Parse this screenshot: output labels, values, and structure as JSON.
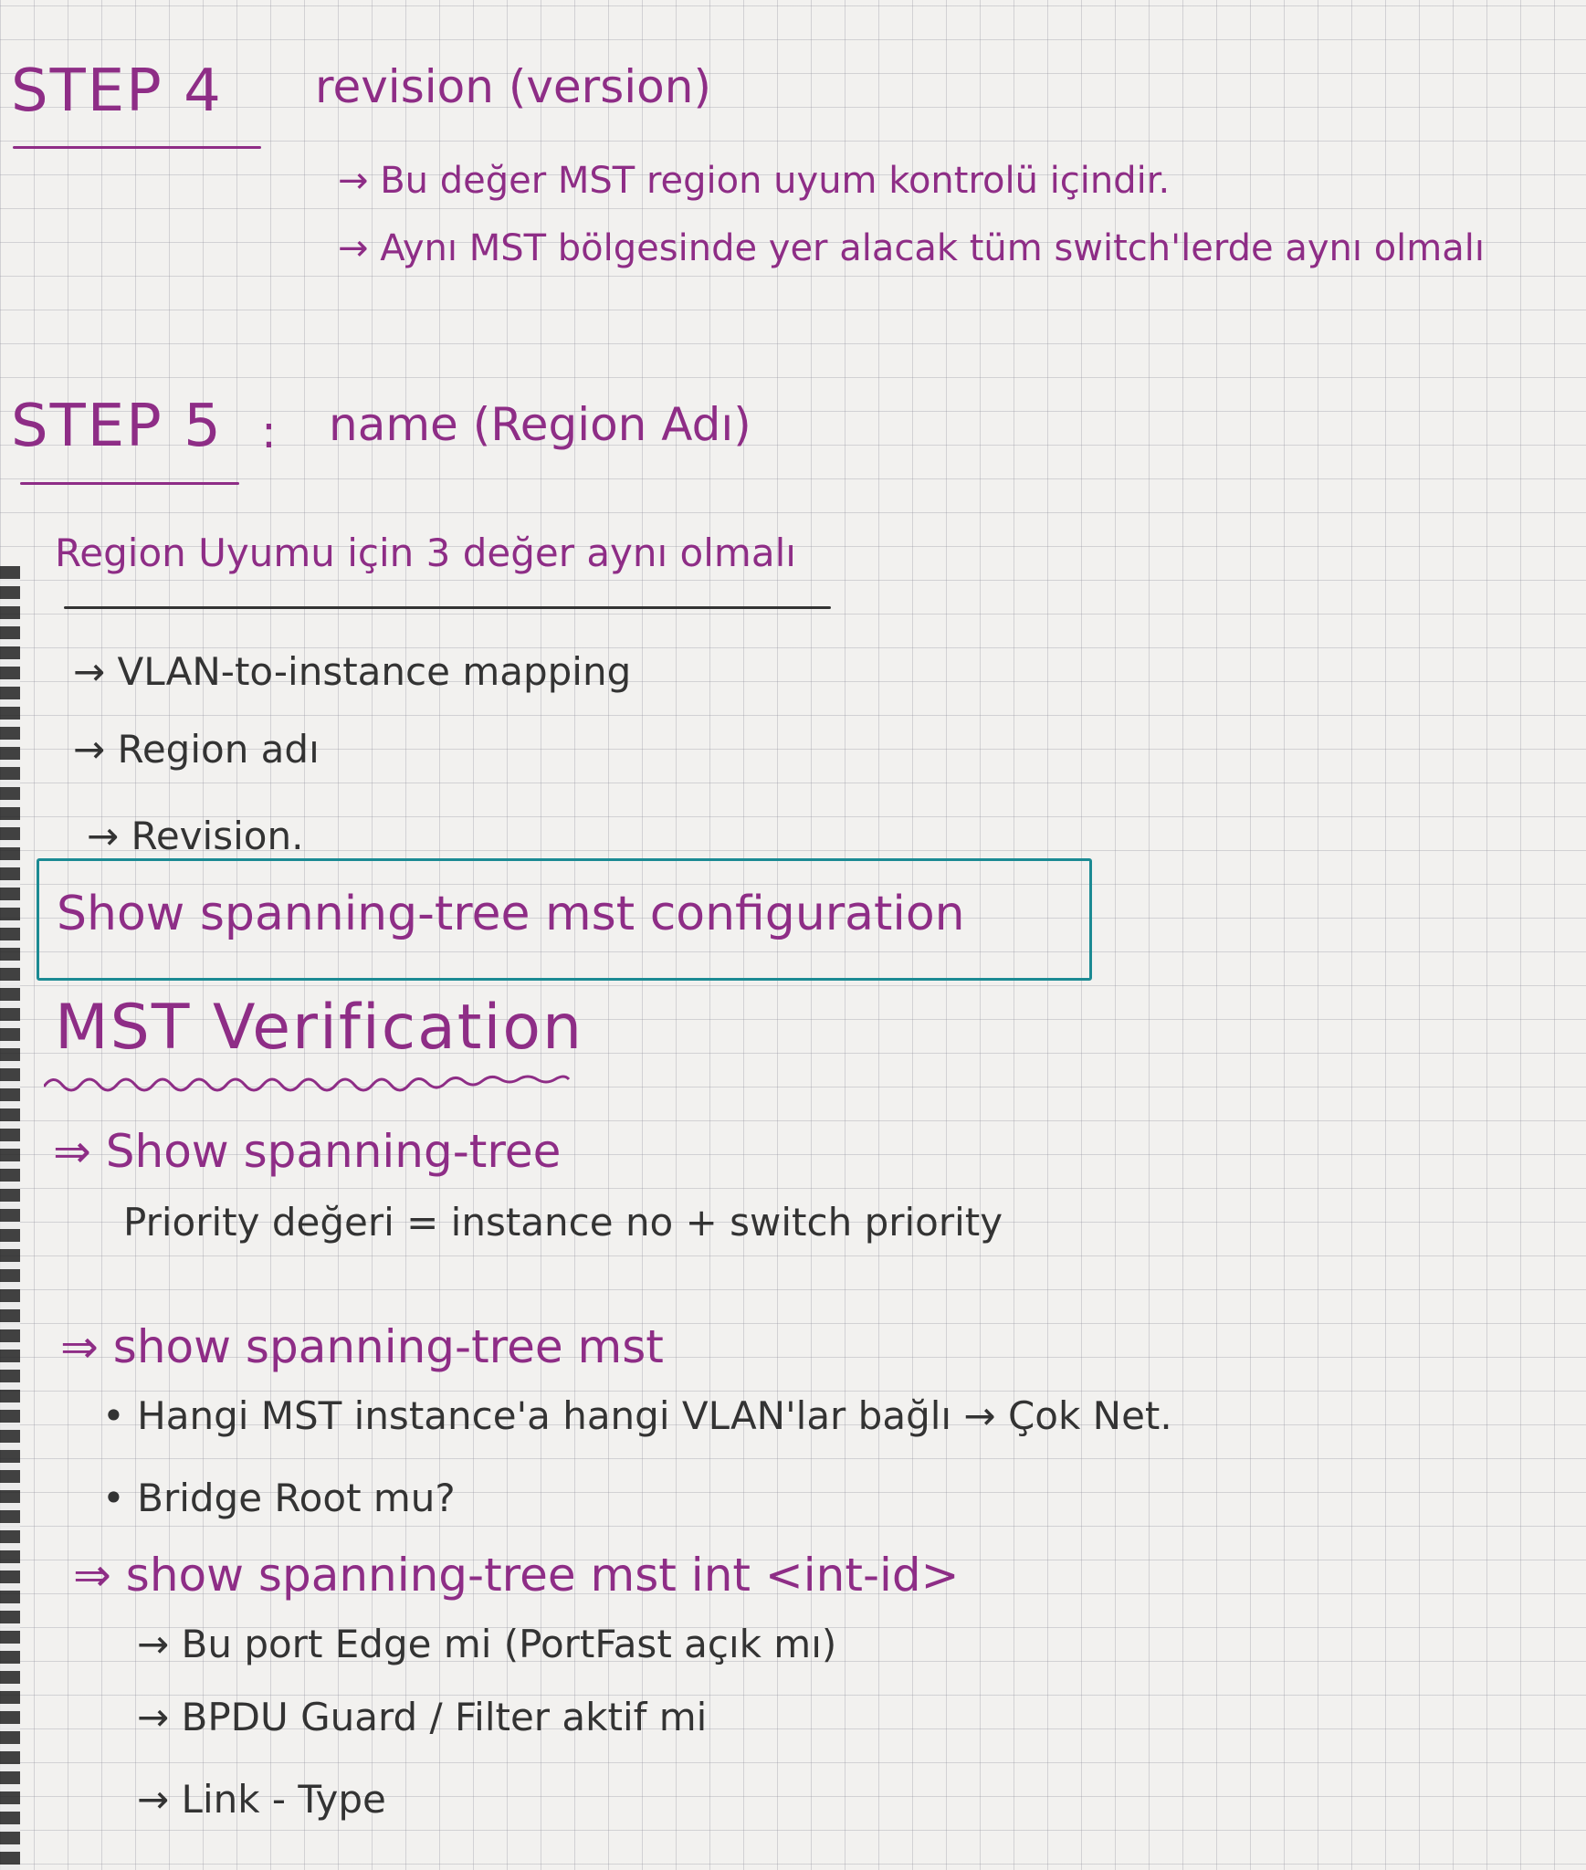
{
  "step4": {
    "heading": "STEP 4",
    "title": "revision (version)",
    "notes": [
      "→ Bu değer MST region uyum kontrolü içindir.",
      "→ Aynı MST bölgesinde yer alacak tüm switch'lerde aynı olmalı"
    ]
  },
  "step5": {
    "heading": "STEP 5",
    "colon": ":",
    "title": "name (Region Adı)"
  },
  "region_match": {
    "title": "Region Uyumu için 3 değer aynı olmalı",
    "items": [
      "→ VLAN-to-instance mapping",
      "→ Region adı",
      "→ Revision."
    ]
  },
  "command_box": "Show spanning-tree mst configuration",
  "verification": {
    "title": "MST Verification",
    "cmd1": "⇒ Show spanning-tree",
    "cmd1_note": "Priority değeri = instance no + switch priority",
    "cmd2": "⇒ show spanning-tree mst",
    "cmd2_bullets": [
      "• Hangi MST instance'a hangi VLAN'lar bağlı → Çok Net.",
      "• Bridge Root mu?"
    ],
    "cmd3": "⇒ show spanning-tree mst int <int-id>",
    "cmd3_items": [
      "→ Bu port Edge mi (PortFast açık mı)",
      "→ BPDU Guard / Filter aktif mi",
      "→ Link - Type"
    ]
  }
}
